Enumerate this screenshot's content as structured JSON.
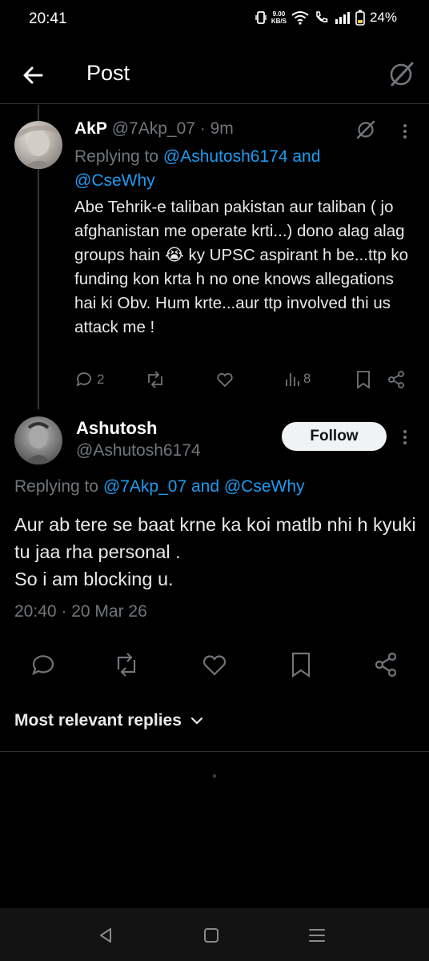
{
  "status": {
    "time": "20:41",
    "net_speed_value": "9.00",
    "net_speed_unit": "KB/S",
    "battery": "24%"
  },
  "header": {
    "title": "Post",
    "back_icon": "arrow-left-icon",
    "grok_icon": "grok-icon"
  },
  "parent_reply": {
    "name": "AkP",
    "handle": "@7Akp_07",
    "sep": " · ",
    "time": "9m",
    "replying_prefix": "Replying to ",
    "replying_user1": "@Ashutosh6174",
    "replying_and": " and",
    "replying_user2": "@CseWhy",
    "body": "Abe Tehrik-e taliban pakistan aur taliban ( jo afghanistan me operate krti...) dono alag alag groups hain 😭 ky UPSC aspirant h be...ttp ko funding kon krta h no one knows allegations hai ki Obv. Hum krte...aur ttp involved thi us attack me !",
    "reply_count": "2",
    "view_count": "8"
  },
  "main_post": {
    "name": "Ashutosh",
    "handle": "@Ashutosh6174",
    "follow_label": "Follow",
    "replying_prefix": "Replying to ",
    "replying_user1": "@7Akp_07",
    "replying_and": " and ",
    "replying_user2": "@CseWhy",
    "body": "Aur ab tere se baat krne ka koi matlb nhi h kyuki tu jaa rha personal .\nSo i am blocking u.",
    "timestamp": "20:40 · 20 Mar 26"
  },
  "sort": {
    "label": "Most relevant replies",
    "icon": "chevron-down-icon"
  },
  "colors": {
    "background": "#000000",
    "link": "#1d9bf0",
    "muted": "#71767b",
    "text": "#e7e9ea",
    "follow_bg": "#eff3f4"
  }
}
